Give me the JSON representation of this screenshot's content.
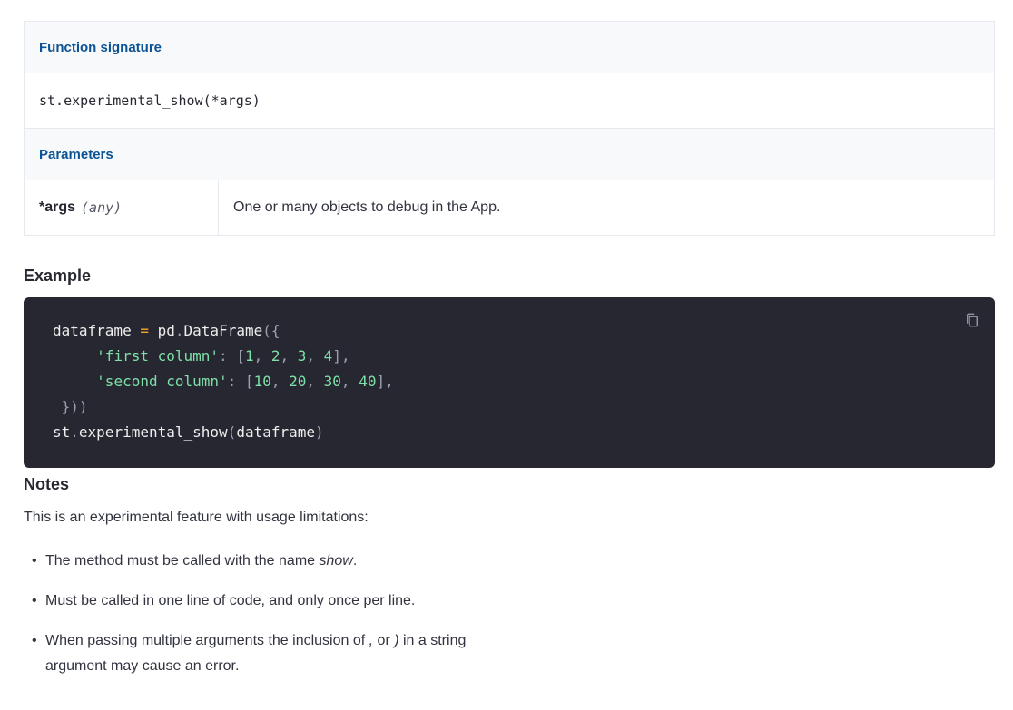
{
  "signature_table": {
    "header_label": "Function signature",
    "signature": "st.experimental_show(*args)",
    "params_label": "Parameters",
    "param": {
      "name": "*args",
      "type": "(any)",
      "description": "One or many objects to debug in the App."
    }
  },
  "example": {
    "heading": "Example",
    "code": {
      "line1": {
        "var": "dataframe",
        "op": "=",
        "rest1": "pd",
        "dot": ".",
        "cls": "DataFrame",
        "open": "({"
      },
      "line2": {
        "indent": "     ",
        "key": "'first column'",
        "colon": ":",
        "open": "[",
        "n1": "1",
        "n2": "2",
        "n3": "3",
        "n4": "4",
        "close": "],"
      },
      "line3": {
        "indent": "     ",
        "key": "'second column'",
        "colon": ":",
        "open": "[",
        "n1": "10",
        "n2": "20",
        "n3": "30",
        "n4": "40",
        "close": "],"
      },
      "line4": " }))",
      "line5": {
        "obj": "st",
        "dot": ".",
        "fn": "experimental_show",
        "open": "(",
        "arg": "dataframe",
        "close": ")"
      }
    },
    "copy_icon": "copy-icon"
  },
  "notes": {
    "heading": "Notes",
    "intro": "This is an experimental feature with usage limitations:",
    "items": [
      {
        "pre": "The method must be called with the name ",
        "em": "show",
        "post": "."
      },
      {
        "pre": "Must be called in one line of code, and only once per line.",
        "em": "",
        "post": ""
      },
      {
        "pre": "When passing multiple arguments the inclusion of ",
        "em": ",",
        "mid": " or ",
        "em2": ")",
        "post": " in a string argument may cause an error."
      }
    ]
  }
}
